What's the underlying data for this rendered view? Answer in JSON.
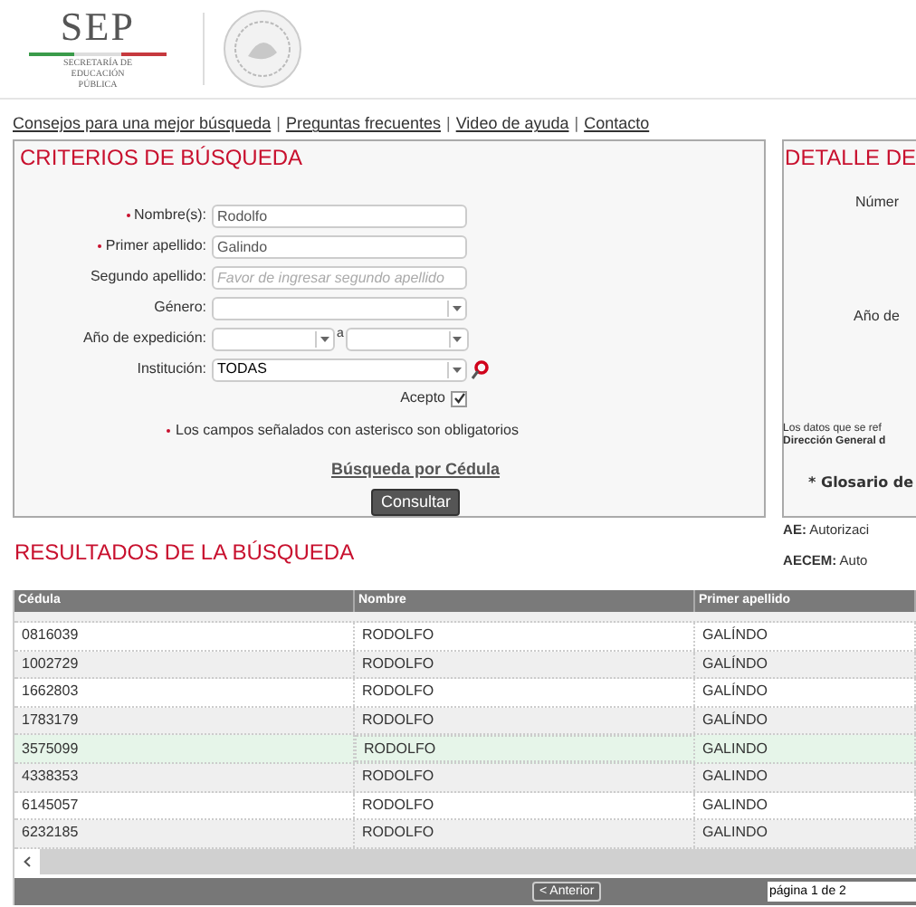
{
  "header": {
    "logo_text": "SEP",
    "logo_subtitle": "SECRETARÍA DE EDUCACIÓN PÚBLICA"
  },
  "links": [
    "Consejos para una mejor búsqueda",
    "Preguntas frecuentes",
    "Video de ayuda",
    "Contacto"
  ],
  "link_separator": "|",
  "criteria": {
    "title": "CRITERIOS DE BÚSQUEDA",
    "fields": [
      {
        "kind": "text",
        "label": "Nombre(s):",
        "required": true,
        "value": "Rodolfo"
      },
      {
        "kind": "text",
        "label": "Primer apellido:",
        "required": true,
        "value": "Galindo"
      },
      {
        "kind": "text",
        "label": "Segundo apellido:",
        "required": false,
        "placeholder": "Favor de ingresar segundo apellido"
      },
      {
        "kind": "select",
        "label": "Género:",
        "required": false
      },
      {
        "kind": "range",
        "label": "Año de expedición:",
        "required": false,
        "separator": "a"
      },
      {
        "kind": "select",
        "label": "Institución:",
        "required": false,
        "value": "TODAS",
        "search": true
      }
    ],
    "accept": {
      "label": "Acepto",
      "checked": true
    },
    "note": "Los campos señalados con asterisco son obligatorios",
    "cedula_link": "Búsqueda por Cédula",
    "submit": "Consultar"
  },
  "detail": {
    "title": "DETALLE DE",
    "labels": [
      "Númer",
      "Año de"
    ],
    "note_lines": [
      "Los datos que se ref",
      "Dirección General d"
    ],
    "glossary_title": "* Glosario de",
    "glossary": [
      "AE: Autorizaci",
      "AECEM: Auto"
    ]
  },
  "results": {
    "title": "RESULTADOS DE LA BÚSQUEDA",
    "columns": [
      "Cédula",
      "Nombre",
      "Primer apellido"
    ],
    "rows": [
      {
        "cells": [
          "0816039",
          "RODOLFO",
          "GALÍNDO"
        ],
        "selected": false
      },
      {
        "cells": [
          "1002729",
          "RODOLFO",
          "GALÍNDO"
        ],
        "selected": false
      },
      {
        "cells": [
          "1662803",
          "RODOLFO",
          "GALÍNDO"
        ],
        "selected": false
      },
      {
        "cells": [
          "1783179",
          "RODOLFO",
          "GALÍNDO"
        ],
        "selected": false
      },
      {
        "cells": [
          "3575099",
          "RODOLFO",
          "GALINDO"
        ],
        "selected": true
      },
      {
        "cells": [
          "4338353",
          "RODOLFO",
          "GALINDO"
        ],
        "selected": false
      },
      {
        "cells": [
          "6145057",
          "RODOLFO",
          "GALINDO"
        ],
        "selected": false
      },
      {
        "cells": [
          "6232185",
          "RODOLFO",
          "GALINDO"
        ],
        "selected": false
      }
    ],
    "prev_button": "< Anterior",
    "page": "página 1 de 2"
  }
}
